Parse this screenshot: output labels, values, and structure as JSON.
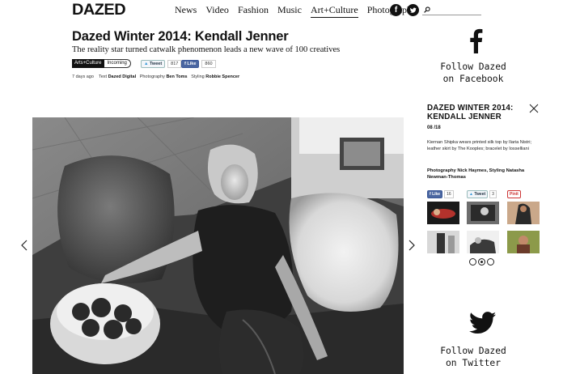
{
  "header": {
    "logo": "DAZED",
    "nav": [
      "News",
      "Video",
      "Fashion",
      "Music",
      "Art+Culture",
      "Photography"
    ],
    "active_nav": "Art+Culture",
    "social": {
      "facebook": "f",
      "twitter": "t"
    }
  },
  "article": {
    "title": "Dazed Winter 2014: Kendall Jenner",
    "subtitle": "The reality star turned catwalk phenomenon leads a new wave of 100 creatives",
    "tags": [
      "Arts+Culture",
      "Incoming"
    ],
    "tweet_label": "Tweet",
    "tweet_count": "817",
    "like_label": "Like",
    "like_count": "860",
    "credits": {
      "time": "7 days ago",
      "text_label": "Text",
      "text_by": "Dazed Digital",
      "photo_label": "Photography",
      "photo_by": "Ben Toms",
      "styling_label": "Styling",
      "styling_by": "Robbie Spencer"
    }
  },
  "sidebar": {
    "follow_facebook": [
      "Follow Dazed",
      "on Facebook"
    ],
    "follow_twitter": [
      "Follow Dazed",
      "on Twitter"
    ],
    "gallery": {
      "title_line1": "DAZED WINTER 2014:",
      "title_line2": "KENDALL JENNER",
      "counter": "08 /18",
      "caption": "Kiernan Shipka wears printed silk top by Ilaria Nistri; leather skirt by The Kooples; bracelet by Iosselliani",
      "credit": "Photography Nick Haymes, Styling Natasha Newman-Thomas",
      "like_label": "Like",
      "like_count": "16",
      "tweet_label": "Tweet",
      "tweet_count": "3",
      "pin_label": "Pinit"
    }
  },
  "colors": {
    "text": "#111111",
    "background": "#ffffff",
    "photo_dark": "#2a2a2a"
  }
}
